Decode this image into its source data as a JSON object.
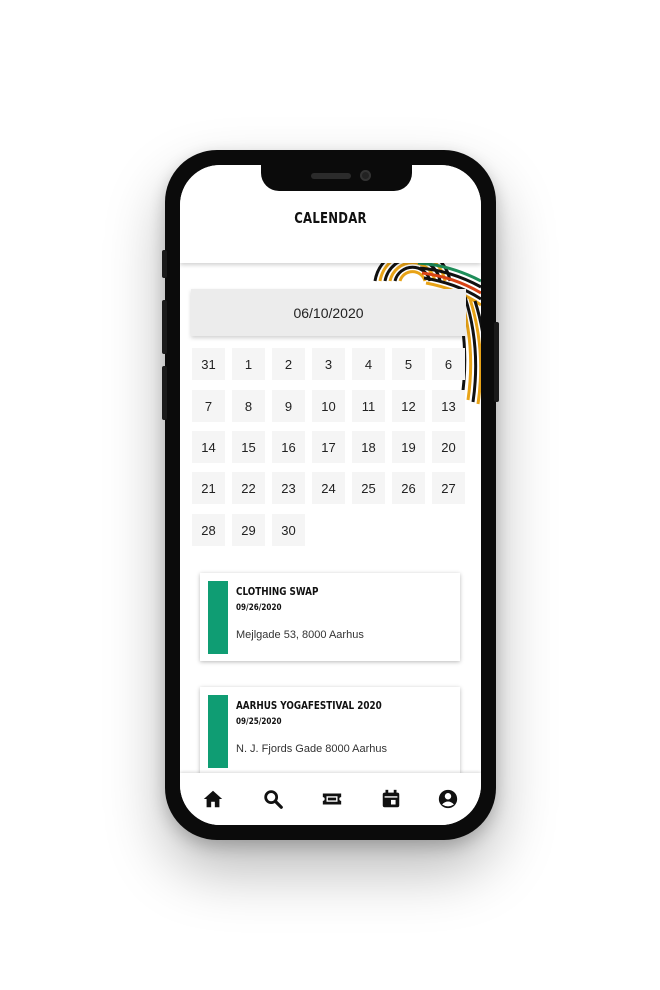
{
  "header": {
    "title": "CALENDAR"
  },
  "calendar": {
    "selected_date": "06/10/2020",
    "rows": [
      [
        "31",
        "1",
        "2",
        "3",
        "4",
        "5",
        "6"
      ],
      [
        "7",
        "8",
        "9",
        "10",
        "11",
        "12",
        "13"
      ],
      [
        "14",
        "15",
        "16",
        "17",
        "18",
        "19",
        "20"
      ],
      [
        "21",
        "22",
        "23",
        "24",
        "25",
        "26",
        "27"
      ],
      [
        "28",
        "29",
        "30"
      ]
    ]
  },
  "events": [
    {
      "title": "CLOTHING SWAP",
      "date": "09/26/2020",
      "address": "Mejlgade 53, 8000 Aarhus",
      "accent": "#0f9d73"
    },
    {
      "title": "AARHUS YOGAFESTIVAL 2020",
      "date": "09/25/2020",
      "address": "N. J. Fjords Gade 8000 Aarhus",
      "accent": "#0f9d73"
    }
  ],
  "nav": {
    "items": [
      {
        "icon": "home-icon"
      },
      {
        "icon": "search-icon"
      },
      {
        "icon": "ticket-icon"
      },
      {
        "icon": "calendar-icon"
      },
      {
        "icon": "account-icon"
      }
    ]
  },
  "colors": {
    "accent": "#0f9d73",
    "deco_orange": "#e8a317",
    "deco_red": "#d84315",
    "deco_green": "#1e8e5a"
  }
}
